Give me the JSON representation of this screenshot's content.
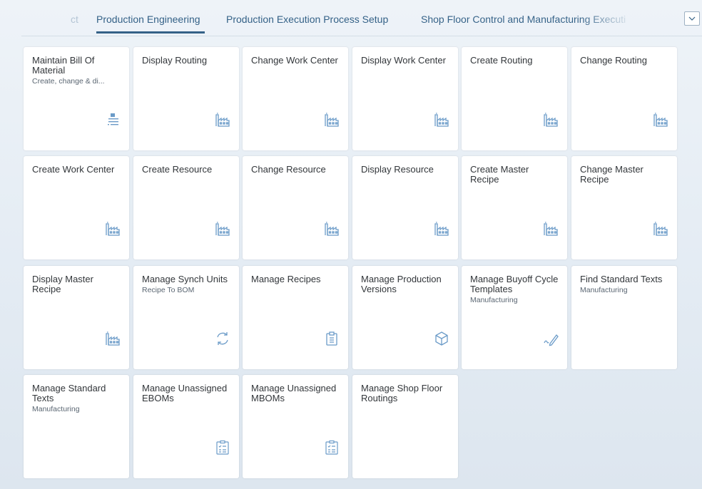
{
  "tabs": [
    {
      "label": "ct"
    },
    {
      "label": "Production Engineering"
    },
    {
      "label": "Production Execution Process Setup"
    },
    {
      "label": "Shop Floor Control and Manufacturing Executi"
    }
  ],
  "tiles": [
    {
      "title": "Maintain Bill Of Material",
      "subtitle": "Create, change & di...",
      "icon": "bom-list-icon"
    },
    {
      "title": "Display Routing",
      "subtitle": "",
      "icon": "factory-icon"
    },
    {
      "title": "Change Work Center",
      "subtitle": "",
      "icon": "factory-icon"
    },
    {
      "title": "Display Work Center",
      "subtitle": "",
      "icon": "factory-icon"
    },
    {
      "title": "Create Routing",
      "subtitle": "",
      "icon": "factory-icon"
    },
    {
      "title": "Change Routing",
      "subtitle": "",
      "icon": "factory-icon"
    },
    {
      "title": "Create Work Center",
      "subtitle": "",
      "icon": "factory-icon"
    },
    {
      "title": "Create Resource",
      "subtitle": "",
      "icon": "factory-icon"
    },
    {
      "title": "Change Resource",
      "subtitle": "",
      "icon": "factory-icon"
    },
    {
      "title": "Display Resource",
      "subtitle": "",
      "icon": "factory-icon"
    },
    {
      "title": "Create Master Recipe",
      "subtitle": "",
      "icon": "factory-icon"
    },
    {
      "title": "Change Master Recipe",
      "subtitle": "",
      "icon": "factory-icon"
    },
    {
      "title": "Display Master Recipe",
      "subtitle": "",
      "icon": "factory-icon"
    },
    {
      "title": "Manage Synch Units",
      "subtitle": "Recipe To BOM",
      "icon": "synchronize-icon"
    },
    {
      "title": "Manage Recipes",
      "subtitle": "",
      "icon": "clipboard-icon"
    },
    {
      "title": "Manage Production Versions",
      "subtitle": "",
      "icon": "product-cube-icon"
    },
    {
      "title": "Manage Buyoff Cycle Templates",
      "subtitle": "Manufacturing",
      "icon": "signature-icon"
    },
    {
      "title": "Find Standard Texts",
      "subtitle": "Manufacturing",
      "icon": ""
    },
    {
      "title": "Manage Standard Texts",
      "subtitle": "Manufacturing",
      "icon": ""
    },
    {
      "title": "Manage Unassigned EBOMs",
      "subtitle": "",
      "icon": "checklist-icon"
    },
    {
      "title": "Manage Unassigned MBOMs",
      "subtitle": "",
      "icon": "checklist-icon"
    },
    {
      "title": "Manage Shop Floor Routings",
      "subtitle": "",
      "icon": ""
    }
  ]
}
